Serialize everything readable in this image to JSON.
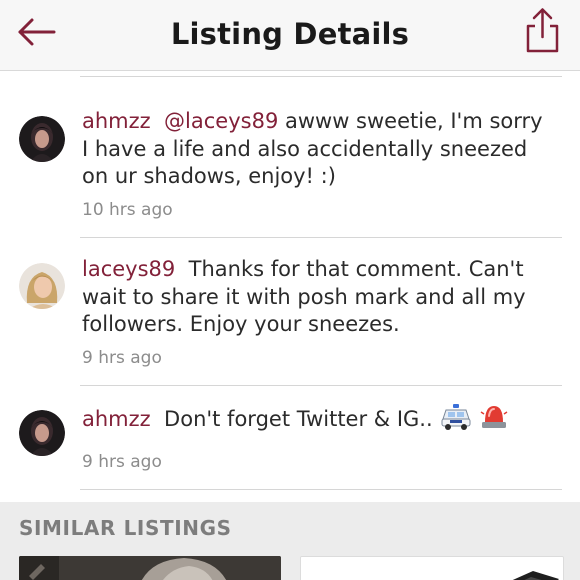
{
  "header": {
    "title": "Listing Details",
    "back_icon": "back-arrow-icon",
    "share_icon": "share-icon",
    "accent_color": "#822139"
  },
  "comments": [
    {
      "username": "ahmzz",
      "mention": "@laceys89",
      "text": " awww sweetie, I'm sorry I have a life and also accidentally sneezed on ur shadows, enjoy! :)",
      "time": "10 hrs ago",
      "avatar_icon": "user-avatar"
    },
    {
      "username": "laceys89",
      "mention": "",
      "text": "Thanks for that comment. Can't wait to share it with posh mark and all my followers. Enjoy your sneezes.",
      "time": "9 hrs ago",
      "avatar_icon": "user-avatar"
    },
    {
      "username": "ahmzz",
      "mention": "",
      "text": "Don't forget Twitter & IG..",
      "time": "9 hrs ago",
      "avatar_icon": "user-avatar",
      "emojis": [
        "police-car-emoji",
        "police-light-emoji"
      ]
    }
  ],
  "similar": {
    "title": "SIMILAR LISTINGS"
  }
}
